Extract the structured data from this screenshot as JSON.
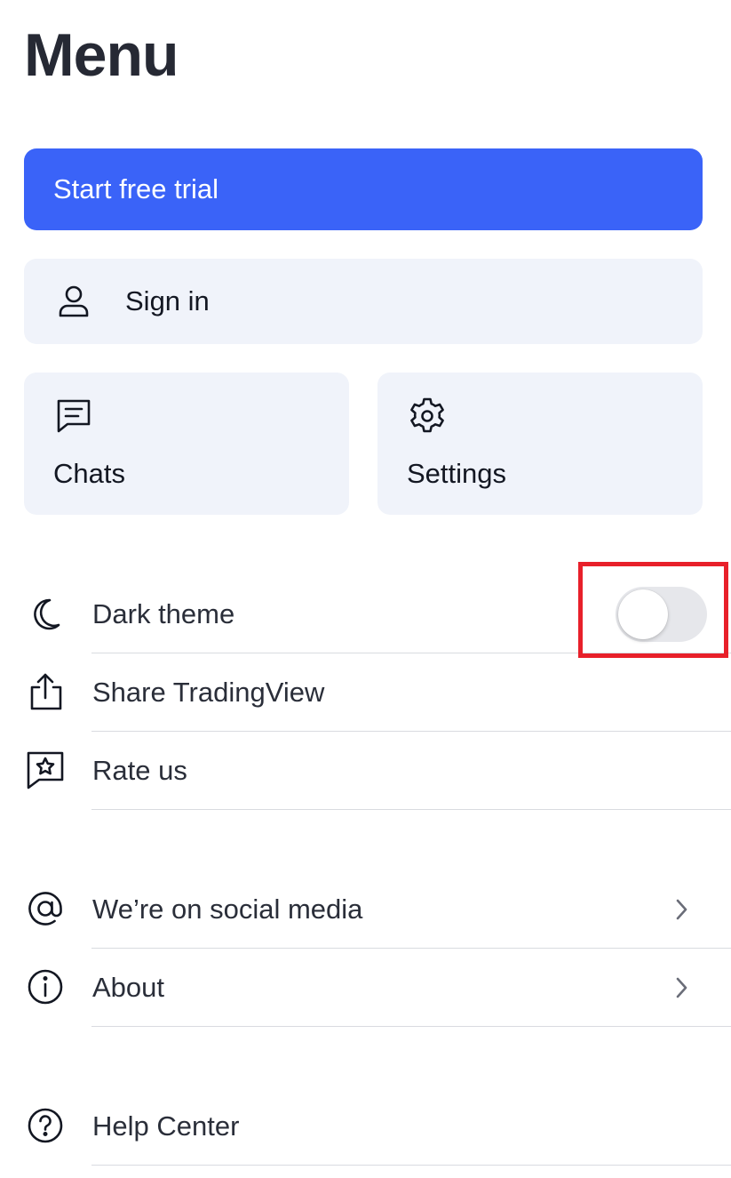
{
  "header": {
    "title": "Menu"
  },
  "actions": {
    "trial_label": "Start free trial",
    "signin_label": "Sign in"
  },
  "tiles": {
    "chats_label": "Chats",
    "settings_label": "Settings"
  },
  "rows": {
    "dark_theme": {
      "label": "Dark theme",
      "toggle_on": false
    },
    "share": {
      "label": "Share TradingView"
    },
    "rate": {
      "label": "Rate us"
    },
    "social": {
      "label": "We’re on social media"
    },
    "about": {
      "label": "About"
    },
    "help": {
      "label": "Help Center"
    }
  },
  "colors": {
    "primary": "#3a63f8",
    "tile_bg": "#f0f3fa",
    "text": "#131722",
    "highlight": "#e8202a",
    "toggle_off": "#e6e7eb"
  },
  "icons": {
    "signin": "user-icon",
    "chats": "chat-icon",
    "settings": "gear-icon",
    "dark_theme": "moon-icon",
    "share": "share-icon",
    "rate": "star-bubble-icon",
    "social": "at-icon",
    "about": "info-icon",
    "help": "question-icon",
    "chevron": "chevron-right-icon"
  }
}
